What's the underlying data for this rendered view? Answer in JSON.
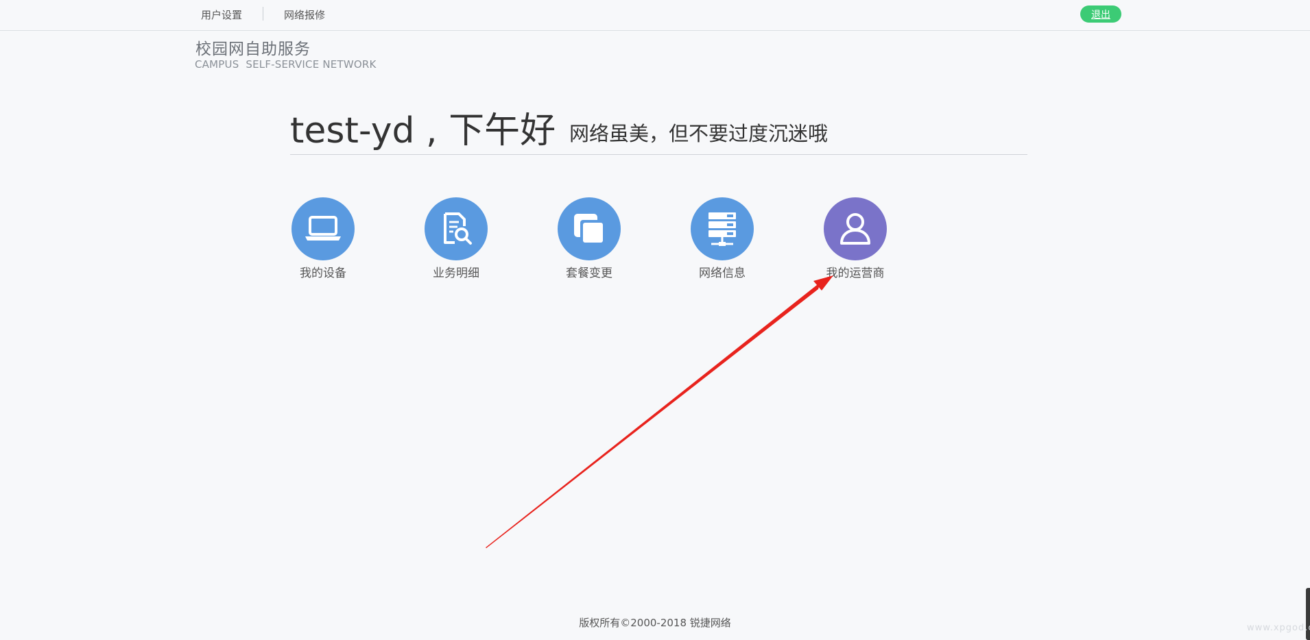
{
  "nav": {
    "user_settings": "用户设置",
    "network_repair": "网络报修",
    "logout": "退出"
  },
  "brand": {
    "title_cn": "校园网自助服务",
    "title_en": "CAMPUS  SELF-SERVICE NETWORK"
  },
  "greeting": {
    "text": "test-yd , 下午好",
    "motto": "网络虽美，但不要过度沉迷哦"
  },
  "services": [
    {
      "label": "我的设备",
      "icon": "laptop-icon",
      "color": "#5a9ae0"
    },
    {
      "label": "业务明细",
      "icon": "document-search-icon",
      "color": "#5a9ae0"
    },
    {
      "label": "套餐变更",
      "icon": "layers-icon",
      "color": "#5a9ae0"
    },
    {
      "label": "网络信息",
      "icon": "server-icon",
      "color": "#5a9ae0"
    },
    {
      "label": "我的运营商",
      "icon": "user-icon",
      "color": "#7a73c9"
    }
  ],
  "annotation": {
    "arrow_color": "#e8231d"
  },
  "footer": {
    "copyright": "版权所有©2000-2018 锐捷网络"
  },
  "watermark": "www.xpgod.com"
}
